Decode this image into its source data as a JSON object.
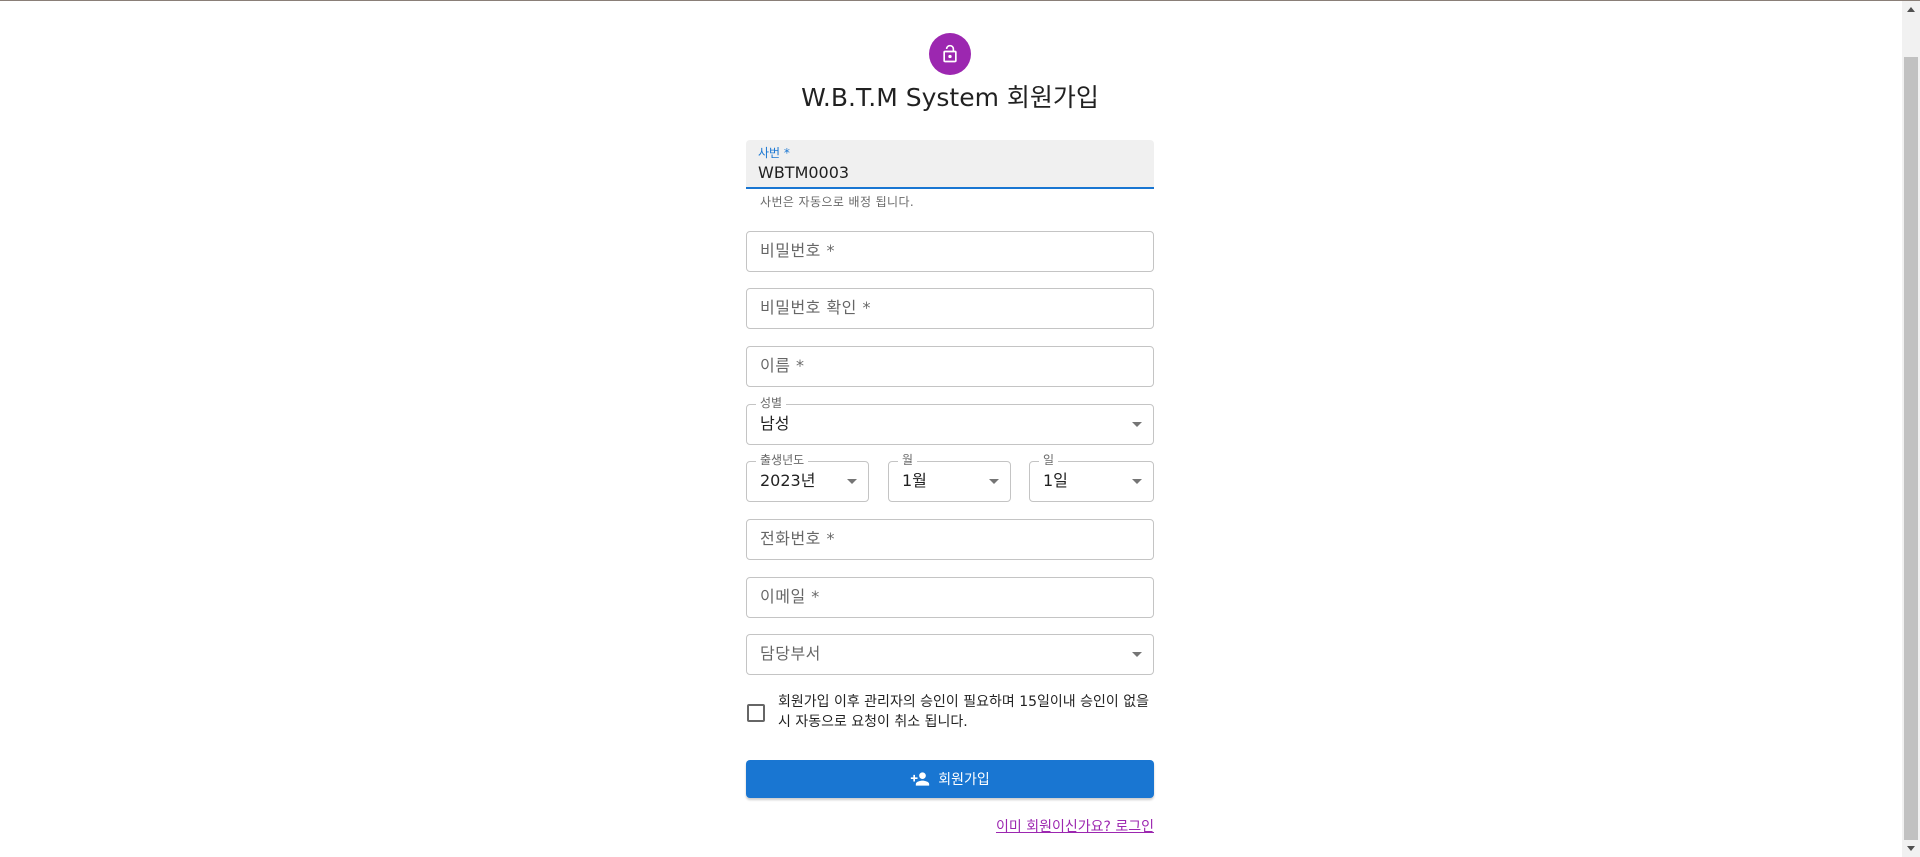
{
  "header": {
    "icon": "lock-open-icon",
    "icon_bg": "#9c27b0",
    "title": "W.B.T.M System 회원가입"
  },
  "form": {
    "employee_id": {
      "label": "사번 *",
      "value": "WBTM0003",
      "helper": "사번은 자동으로 배정 됩니다."
    },
    "password": {
      "label": "비밀번호 *"
    },
    "password_confirm": {
      "label": "비밀번호 확인 *"
    },
    "name": {
      "label": "이름 *"
    },
    "gender": {
      "label": "성별",
      "value": "남성"
    },
    "birth_year": {
      "label": "출생년도",
      "value": "2023년"
    },
    "birth_month": {
      "label": "월",
      "value": "1월"
    },
    "birth_day": {
      "label": "일",
      "value": "1일"
    },
    "phone": {
      "label": "전화번호 *"
    },
    "email": {
      "label": "이메일 *"
    },
    "department": {
      "label": "담당부서"
    },
    "agreement": {
      "text": "회원가입 이후 관리자의 승인이 필요하며 15일이내 승인이 없을시 자동으로 요청이 취소 됩니다.",
      "checked": false
    },
    "submit_label": "회원가입",
    "submit_icon": "person-add-icon",
    "login_link": "이미 회원이신가요? 로그인"
  },
  "colors": {
    "primary": "#1976d2",
    "secondary": "#9c27b0"
  }
}
